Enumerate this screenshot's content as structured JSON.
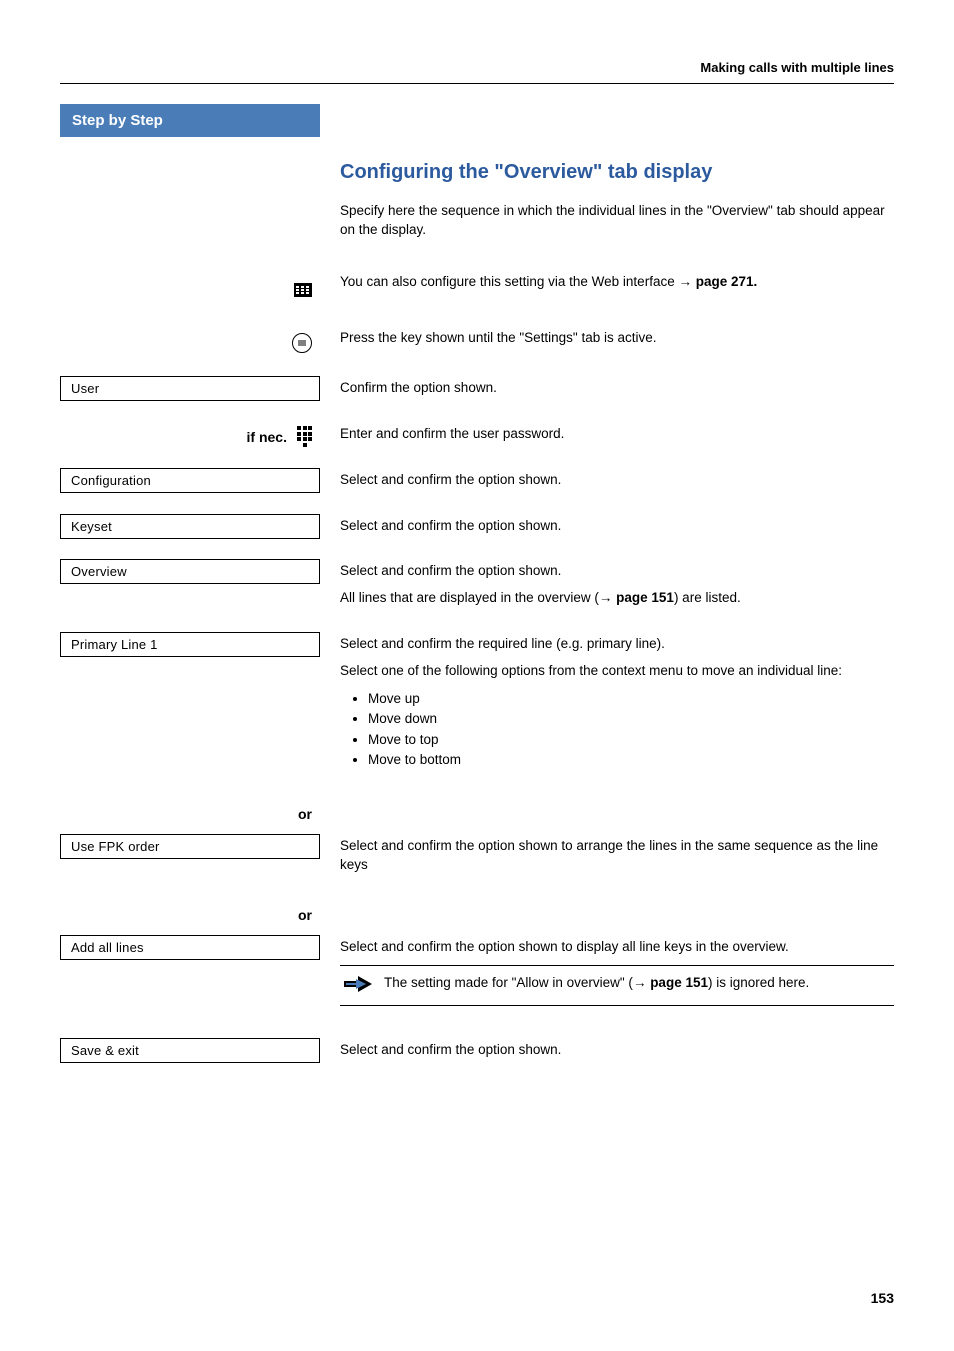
{
  "header": {
    "title": "Making calls with multiple lines"
  },
  "sidebar": {
    "step_header": "Step by Step",
    "if_nec_label": "if nec.",
    "or_label": "or",
    "options": {
      "user": "User",
      "configuration": "Configuration",
      "keyset": "Keyset",
      "overview": "Overview",
      "primary_line": "Primary Line 1",
      "use_fpk": "Use FPK order",
      "add_all": "Add all lines",
      "save_exit": "Save & exit"
    }
  },
  "content": {
    "section_title": "Configuring the \"Overview\" tab display",
    "intro_text": "Specify here the sequence in which the individual lines in the \"Overview\" tab should appear on the display.",
    "web_interface_prefix": "You can also configure this setting via the Web interface ",
    "web_interface_ref": "→ page 271.",
    "press_key": "Press the key shown until the \"Settings\" tab is active.",
    "confirm_option": "Confirm the option shown.",
    "enter_password": "Enter and confirm the user password.",
    "select_confirm": "Select and confirm the option shown.",
    "all_lines_prefix": "All lines that are displayed in the overview (",
    "all_lines_ref": "→ page 151",
    "all_lines_suffix": ") are listed.",
    "select_required_line": "Select and confirm the required line (e.g. primary line).",
    "move_intro": "Select one of the following options from the context menu to move an individual line:",
    "move_options": [
      "Move up",
      "Move down",
      "Move to top",
      "Move to bottom"
    ],
    "fpk_arrange": "Select and confirm the option shown to arrange the lines in the same sequence as the line keys",
    "add_all_text": "Select and confirm the option shown to display all line keys in the overview.",
    "note_prefix": "The setting made for \"Allow in overview\" (",
    "note_ref": "→ page 151",
    "note_suffix": ") is ignored here.",
    "save_exit_text": "Select and confirm the option shown."
  },
  "page_number": "153"
}
